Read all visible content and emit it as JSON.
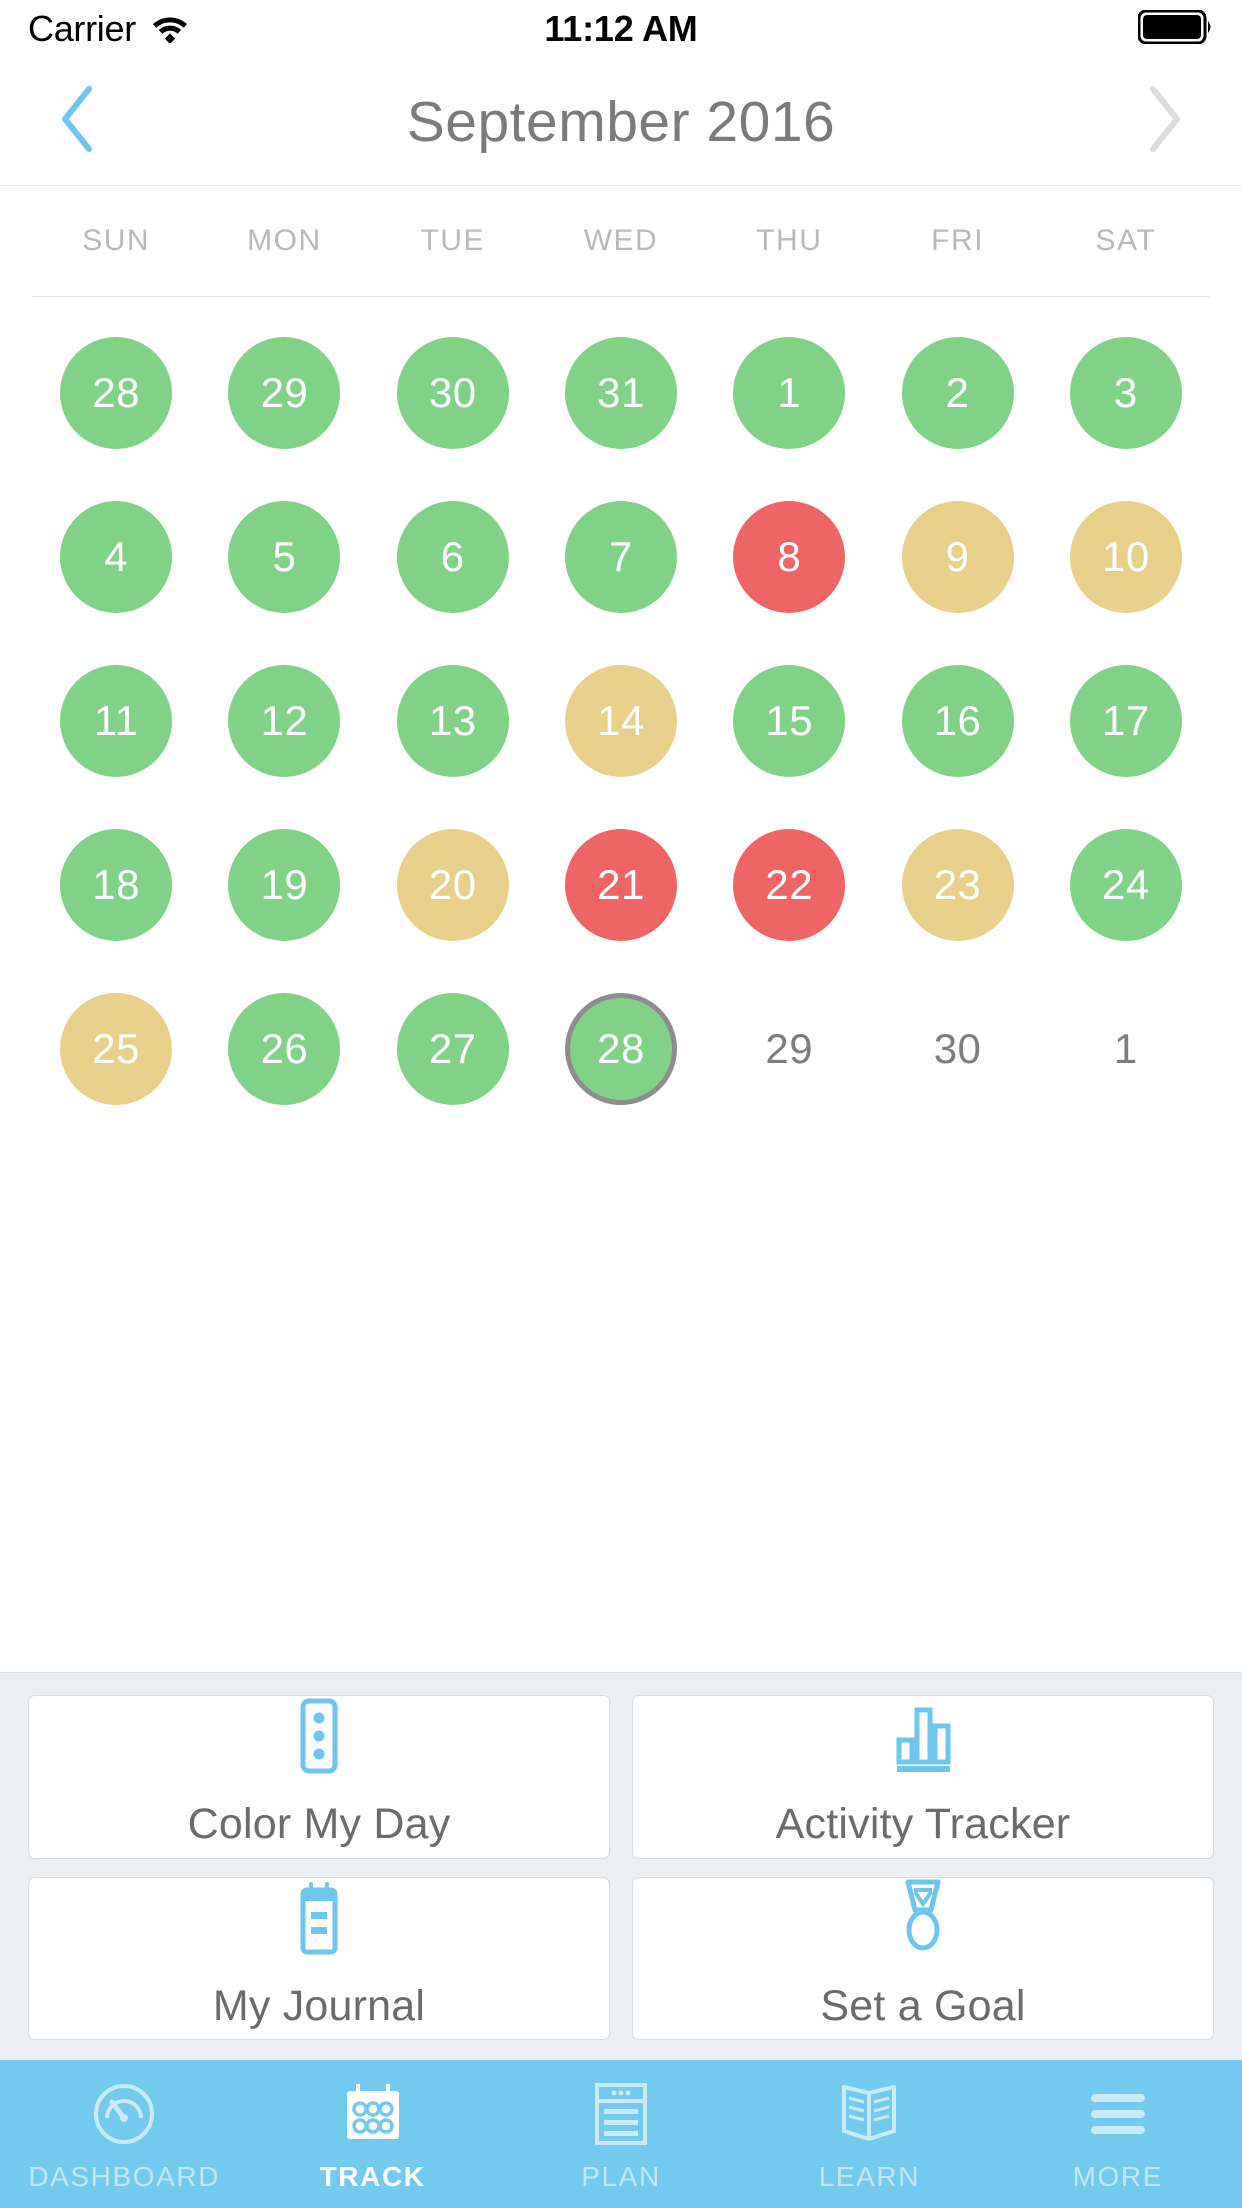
{
  "status_bar": {
    "carrier": "Carrier",
    "time": "11:12 AM",
    "wifi_icon": "wifi-icon",
    "battery_icon": "battery-full-icon"
  },
  "header": {
    "title": "September 2016",
    "prev_icon": "chevron-left-icon",
    "next_icon": "chevron-right-icon",
    "prev_color": "#6fc6ec",
    "next_color": "#dcdcdc"
  },
  "calendar": {
    "weekdays": [
      "SUN",
      "MON",
      "TUE",
      "WED",
      "THU",
      "FRI",
      "SAT"
    ],
    "legend_colors": {
      "green": "#80d287",
      "yellow": "#e8cf8a",
      "red": "#ef6566",
      "none": "transparent",
      "today_ring": "#8d8d8d"
    },
    "weeks": [
      [
        {
          "label": "28",
          "state": "green",
          "today": false
        },
        {
          "label": "29",
          "state": "green",
          "today": false
        },
        {
          "label": "30",
          "state": "green",
          "today": false
        },
        {
          "label": "31",
          "state": "green",
          "today": false
        },
        {
          "label": "1",
          "state": "green",
          "today": false
        },
        {
          "label": "2",
          "state": "green",
          "today": false
        },
        {
          "label": "3",
          "state": "green",
          "today": false
        }
      ],
      [
        {
          "label": "4",
          "state": "green",
          "today": false
        },
        {
          "label": "5",
          "state": "green",
          "today": false
        },
        {
          "label": "6",
          "state": "green",
          "today": false
        },
        {
          "label": "7",
          "state": "green",
          "today": false
        },
        {
          "label": "8",
          "state": "red",
          "today": false
        },
        {
          "label": "9",
          "state": "yellow",
          "today": false
        },
        {
          "label": "10",
          "state": "yellow",
          "today": false
        }
      ],
      [
        {
          "label": "11",
          "state": "green",
          "today": false
        },
        {
          "label": "12",
          "state": "green",
          "today": false
        },
        {
          "label": "13",
          "state": "green",
          "today": false
        },
        {
          "label": "14",
          "state": "yellow",
          "today": false
        },
        {
          "label": "15",
          "state": "green",
          "today": false
        },
        {
          "label": "16",
          "state": "green",
          "today": false
        },
        {
          "label": "17",
          "state": "green",
          "today": false
        }
      ],
      [
        {
          "label": "18",
          "state": "green",
          "today": false
        },
        {
          "label": "19",
          "state": "green",
          "today": false
        },
        {
          "label": "20",
          "state": "yellow",
          "today": false
        },
        {
          "label": "21",
          "state": "red",
          "today": false
        },
        {
          "label": "22",
          "state": "red",
          "today": false
        },
        {
          "label": "23",
          "state": "yellow",
          "today": false
        },
        {
          "label": "24",
          "state": "green",
          "today": false
        }
      ],
      [
        {
          "label": "25",
          "state": "yellow",
          "today": false
        },
        {
          "label": "26",
          "state": "green",
          "today": false
        },
        {
          "label": "27",
          "state": "green",
          "today": false
        },
        {
          "label": "28",
          "state": "green",
          "today": true
        },
        {
          "label": "29",
          "state": "none",
          "today": false
        },
        {
          "label": "30",
          "state": "none",
          "today": false
        },
        {
          "label": "1",
          "state": "none",
          "today": false
        }
      ]
    ]
  },
  "shortcuts": {
    "accent_color": "#6fc6ec",
    "cards": [
      {
        "label": "Color My Day",
        "icon": "traffic-light-icon"
      },
      {
        "label": "Activity Tracker",
        "icon": "bar-chart-icon"
      },
      {
        "label": "My Journal",
        "icon": "notepad-icon"
      },
      {
        "label": "Set a Goal",
        "icon": "medal-icon"
      }
    ]
  },
  "tabbar": {
    "background": "#74c9ef",
    "tabs": [
      {
        "label": "DASHBOARD",
        "icon": "gauge-icon",
        "active": false
      },
      {
        "label": "TRACK",
        "icon": "calendar-icon",
        "active": true
      },
      {
        "label": "PLAN",
        "icon": "document-icon",
        "active": false
      },
      {
        "label": "LEARN",
        "icon": "book-icon",
        "active": false
      },
      {
        "label": "MORE",
        "icon": "hamburger-icon",
        "active": false
      }
    ]
  }
}
